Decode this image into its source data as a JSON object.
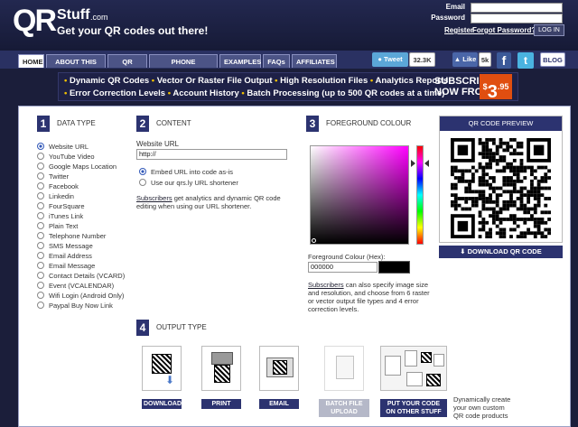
{
  "header": {
    "logo_qr": "QR",
    "logo_stuff": "Stuff",
    "logo_com": ".com",
    "tagline": "Get your QR codes out there!",
    "email_label": "Email",
    "password_label": "Password",
    "register_link": "Register",
    "forgot_link": "Forgot Password?",
    "login_button": "LOG IN"
  },
  "nav": {
    "tabs": [
      {
        "label": "HOME",
        "active": true
      },
      {
        "label": "ABOUT THIS SITE"
      },
      {
        "label": "QR CODES"
      },
      {
        "label": "PHONE SOFTWARE"
      },
      {
        "label": "EXAMPLES"
      },
      {
        "label": "FAQs"
      },
      {
        "label": "AFFILIATES"
      }
    ],
    "tweet_label": "Tweet",
    "tweet_count": "32.3K",
    "like_label": "Like",
    "like_count": "5k",
    "blog_label": "BLOG"
  },
  "banner": {
    "row1": [
      "Dynamic QR Codes",
      "Vector Or Raster File Output",
      "High Resolution Files",
      "Analytics Reports"
    ],
    "row2": [
      "Error Correction Levels",
      "Account History",
      "Batch Processing (up to 500 QR codes at a time)"
    ],
    "subscribe_line1": "SUBSCRIBE",
    "subscribe_line2": "NOW FROM",
    "price_prefix": "$",
    "price_main": "3",
    "price_cents": ".95"
  },
  "step1": {
    "num": "1",
    "title": "DATA TYPE",
    "options": [
      {
        "label": "Website URL",
        "selected": true
      },
      {
        "label": "YouTube Video"
      },
      {
        "label": "Google Maps Location"
      },
      {
        "label": "Twitter"
      },
      {
        "label": "Facebook"
      },
      {
        "label": "Linkedin"
      },
      {
        "label": "FourSquare"
      },
      {
        "label": "iTunes Link"
      },
      {
        "label": "Plain Text"
      },
      {
        "label": "Telephone Number"
      },
      {
        "label": "SMS Message"
      },
      {
        "label": "Email Address"
      },
      {
        "label": "Email Message"
      },
      {
        "label": "Contact Details (VCARD)"
      },
      {
        "label": "Event (VCALENDAR)"
      },
      {
        "label": "Wifi Login (Android Only)"
      },
      {
        "label": "Paypal Buy Now Link"
      }
    ]
  },
  "step2": {
    "num": "2",
    "title": "CONTENT",
    "url_label": "Website URL",
    "url_value": "http://",
    "embed_option": "Embed URL into code as-is",
    "shorten_option": "Use our qrs.ly URL shortener",
    "subscribers_link": "Subscribers",
    "subscribers_text": " get analytics and dynamic QR code editing when using our URL shortener."
  },
  "step3": {
    "num": "3",
    "title": "FOREGROUND COLOUR",
    "hex_label": "Foreground Colour (Hex):",
    "hex_value": "000000",
    "swatch_color": "#000000",
    "subscribers_link": "Subscribers",
    "subscribers_text": " can also specify image size and resolution, and choose from 6 raster or vector output file types and 4 error correction levels."
  },
  "preview": {
    "title": "QR CODE PREVIEW",
    "download_button": "DOWNLOAD QR CODE"
  },
  "step4": {
    "num": "4",
    "title": "OUTPUT TYPE",
    "download": "DOWNLOAD",
    "print": "PRINT",
    "email": "EMAIL",
    "batch_line1": "BATCH FILE",
    "batch_line2": "UPLOAD",
    "other_line1": "PUT YOUR CODE",
    "other_line2": "ON OTHER STUFF",
    "other_desc": [
      "Dynamically create",
      "your own custom",
      "QR code products"
    ]
  },
  "colors": {
    "brand_dark": "#2c3370",
    "header_bg": "#1b1e3a",
    "accent_yellow": "#f0c000",
    "price_orange": "#e04e10"
  }
}
